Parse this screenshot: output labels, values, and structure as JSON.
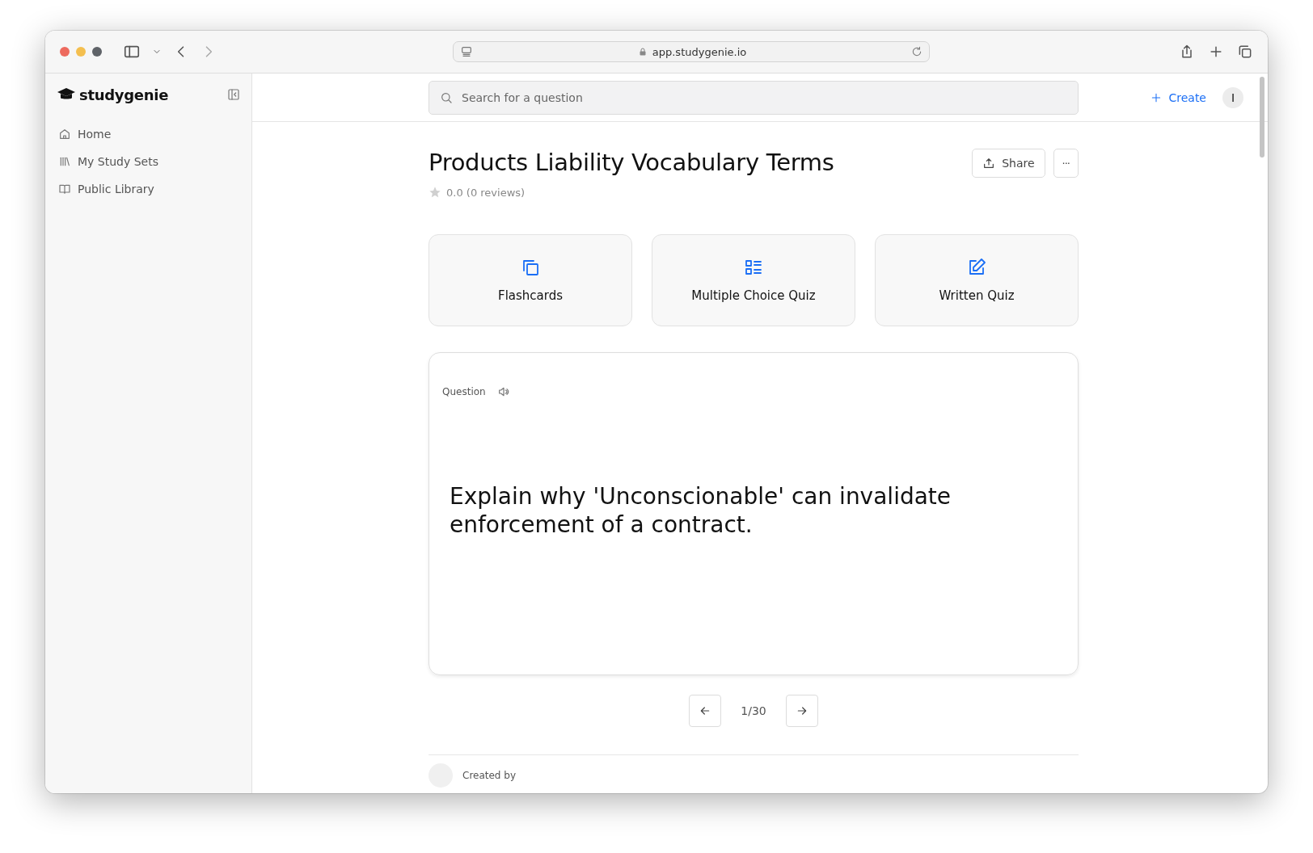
{
  "browser": {
    "url": "app.studygenie.io"
  },
  "sidebar": {
    "logo": "studygenie",
    "items": [
      {
        "label": "Home",
        "selected": false
      },
      {
        "label": "My Study Sets",
        "selected": false
      },
      {
        "label": "Public Library",
        "selected": false
      }
    ]
  },
  "header": {
    "search": {
      "placeholder": "Search for a question"
    },
    "create_label": "Create",
    "avatar_initial": "I"
  },
  "study_set": {
    "title": "Products Liability Vocabulary Terms",
    "rating": "0.0 (0 reviews)",
    "share_label": "Share",
    "more_label": "···"
  },
  "modes": [
    {
      "label": "Flashcards"
    },
    {
      "label": "Multiple Choice Quiz"
    },
    {
      "label": "Written Quiz"
    }
  ],
  "card": {
    "side_label": "Question",
    "text": "Explain why 'Unconscionable' can invalidate enforcement of a contract."
  },
  "pager": {
    "position": "1/30"
  },
  "footer": {
    "created_by_label": "Created by"
  }
}
